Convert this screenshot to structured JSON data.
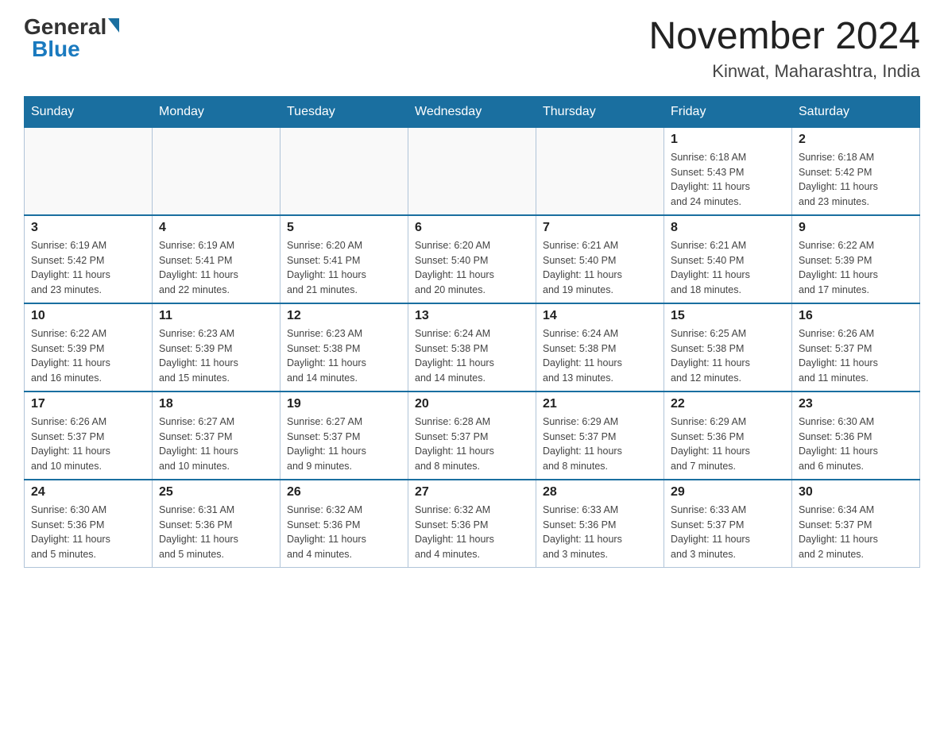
{
  "header": {
    "logo_general": "General",
    "logo_blue": "Blue",
    "month_year": "November 2024",
    "location": "Kinwat, Maharashtra, India"
  },
  "days_of_week": [
    "Sunday",
    "Monday",
    "Tuesday",
    "Wednesday",
    "Thursday",
    "Friday",
    "Saturday"
  ],
  "weeks": [
    [
      {
        "day": "",
        "info": ""
      },
      {
        "day": "",
        "info": ""
      },
      {
        "day": "",
        "info": ""
      },
      {
        "day": "",
        "info": ""
      },
      {
        "day": "",
        "info": ""
      },
      {
        "day": "1",
        "info": "Sunrise: 6:18 AM\nSunset: 5:43 PM\nDaylight: 11 hours\nand 24 minutes."
      },
      {
        "day": "2",
        "info": "Sunrise: 6:18 AM\nSunset: 5:42 PM\nDaylight: 11 hours\nand 23 minutes."
      }
    ],
    [
      {
        "day": "3",
        "info": "Sunrise: 6:19 AM\nSunset: 5:42 PM\nDaylight: 11 hours\nand 23 minutes."
      },
      {
        "day": "4",
        "info": "Sunrise: 6:19 AM\nSunset: 5:41 PM\nDaylight: 11 hours\nand 22 minutes."
      },
      {
        "day": "5",
        "info": "Sunrise: 6:20 AM\nSunset: 5:41 PM\nDaylight: 11 hours\nand 21 minutes."
      },
      {
        "day": "6",
        "info": "Sunrise: 6:20 AM\nSunset: 5:40 PM\nDaylight: 11 hours\nand 20 minutes."
      },
      {
        "day": "7",
        "info": "Sunrise: 6:21 AM\nSunset: 5:40 PM\nDaylight: 11 hours\nand 19 minutes."
      },
      {
        "day": "8",
        "info": "Sunrise: 6:21 AM\nSunset: 5:40 PM\nDaylight: 11 hours\nand 18 minutes."
      },
      {
        "day": "9",
        "info": "Sunrise: 6:22 AM\nSunset: 5:39 PM\nDaylight: 11 hours\nand 17 minutes."
      }
    ],
    [
      {
        "day": "10",
        "info": "Sunrise: 6:22 AM\nSunset: 5:39 PM\nDaylight: 11 hours\nand 16 minutes."
      },
      {
        "day": "11",
        "info": "Sunrise: 6:23 AM\nSunset: 5:39 PM\nDaylight: 11 hours\nand 15 minutes."
      },
      {
        "day": "12",
        "info": "Sunrise: 6:23 AM\nSunset: 5:38 PM\nDaylight: 11 hours\nand 14 minutes."
      },
      {
        "day": "13",
        "info": "Sunrise: 6:24 AM\nSunset: 5:38 PM\nDaylight: 11 hours\nand 14 minutes."
      },
      {
        "day": "14",
        "info": "Sunrise: 6:24 AM\nSunset: 5:38 PM\nDaylight: 11 hours\nand 13 minutes."
      },
      {
        "day": "15",
        "info": "Sunrise: 6:25 AM\nSunset: 5:38 PM\nDaylight: 11 hours\nand 12 minutes."
      },
      {
        "day": "16",
        "info": "Sunrise: 6:26 AM\nSunset: 5:37 PM\nDaylight: 11 hours\nand 11 minutes."
      }
    ],
    [
      {
        "day": "17",
        "info": "Sunrise: 6:26 AM\nSunset: 5:37 PM\nDaylight: 11 hours\nand 10 minutes."
      },
      {
        "day": "18",
        "info": "Sunrise: 6:27 AM\nSunset: 5:37 PM\nDaylight: 11 hours\nand 10 minutes."
      },
      {
        "day": "19",
        "info": "Sunrise: 6:27 AM\nSunset: 5:37 PM\nDaylight: 11 hours\nand 9 minutes."
      },
      {
        "day": "20",
        "info": "Sunrise: 6:28 AM\nSunset: 5:37 PM\nDaylight: 11 hours\nand 8 minutes."
      },
      {
        "day": "21",
        "info": "Sunrise: 6:29 AM\nSunset: 5:37 PM\nDaylight: 11 hours\nand 8 minutes."
      },
      {
        "day": "22",
        "info": "Sunrise: 6:29 AM\nSunset: 5:36 PM\nDaylight: 11 hours\nand 7 minutes."
      },
      {
        "day": "23",
        "info": "Sunrise: 6:30 AM\nSunset: 5:36 PM\nDaylight: 11 hours\nand 6 minutes."
      }
    ],
    [
      {
        "day": "24",
        "info": "Sunrise: 6:30 AM\nSunset: 5:36 PM\nDaylight: 11 hours\nand 5 minutes."
      },
      {
        "day": "25",
        "info": "Sunrise: 6:31 AM\nSunset: 5:36 PM\nDaylight: 11 hours\nand 5 minutes."
      },
      {
        "day": "26",
        "info": "Sunrise: 6:32 AM\nSunset: 5:36 PM\nDaylight: 11 hours\nand 4 minutes."
      },
      {
        "day": "27",
        "info": "Sunrise: 6:32 AM\nSunset: 5:36 PM\nDaylight: 11 hours\nand 4 minutes."
      },
      {
        "day": "28",
        "info": "Sunrise: 6:33 AM\nSunset: 5:36 PM\nDaylight: 11 hours\nand 3 minutes."
      },
      {
        "day": "29",
        "info": "Sunrise: 6:33 AM\nSunset: 5:37 PM\nDaylight: 11 hours\nand 3 minutes."
      },
      {
        "day": "30",
        "info": "Sunrise: 6:34 AM\nSunset: 5:37 PM\nDaylight: 11 hours\nand 2 minutes."
      }
    ]
  ]
}
